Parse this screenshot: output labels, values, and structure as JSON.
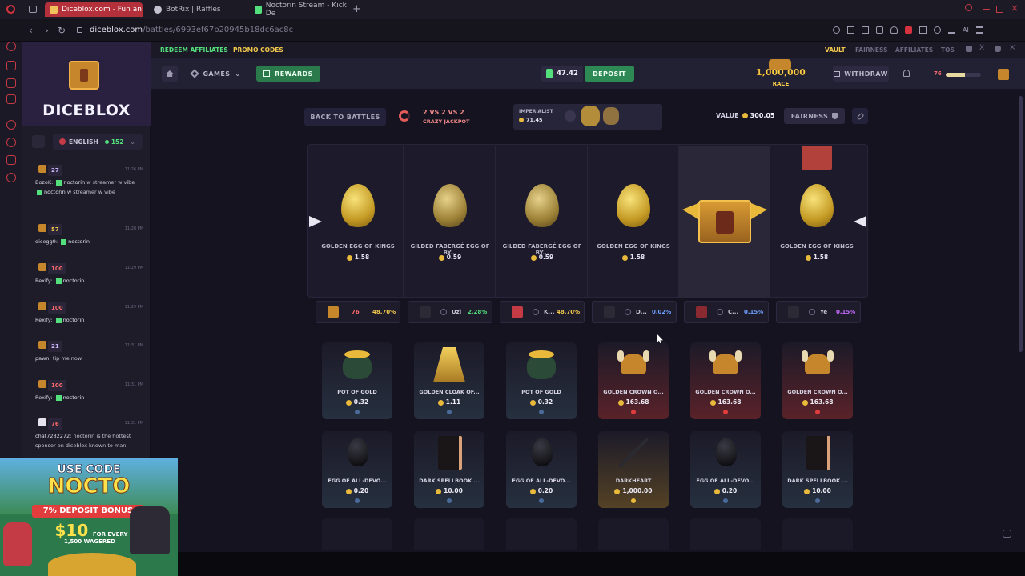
{
  "browser": {
    "tabs": [
      {
        "label": "Diceblox.com - Fun an"
      },
      {
        "label": "BotRix | Raffles"
      },
      {
        "label": "Noctorin Stream - Kick De"
      }
    ],
    "url_host": "diceblox.com",
    "url_path": "/battles/6993ef67b20945b18dc6ac8c"
  },
  "sidebar": {
    "logo_text": "DICEBLOX",
    "language": "ENGLISH",
    "online_count": "152",
    "chat": [
      {
        "level": "27",
        "time": "11:26 PM",
        "user": "BozoK:",
        "tag": "noctorin",
        "text": "w streamer w vibe",
        "tag2": "noctorin",
        "text2": "w streamer w vibe"
      },
      {
        "level": "57",
        "time": "11:28 PM",
        "user": "dicegg9:",
        "tag": "noctorin",
        "text": ""
      },
      {
        "level": "100",
        "time": "11:29 PM",
        "user": "Rexify:",
        "tag": "noctorin",
        "text": ""
      },
      {
        "level": "100",
        "time": "11:29 PM",
        "user": "Rexify:",
        "tag": "noctorin",
        "text": ""
      },
      {
        "level": "21",
        "time": "11:31 PM",
        "user": "pawn:",
        "tag": "",
        "text": "tip me now"
      },
      {
        "level": "100",
        "time": "11:31 PM",
        "user": "Rexify:",
        "tag": "noctorin",
        "text": ""
      },
      {
        "level": "76",
        "time": "11:31 PM",
        "user": "chat7282272:",
        "tag": "",
        "text": "noctorin is the hottest sponsor on diceblox known to man"
      }
    ]
  },
  "promo": {
    "line1": "USE CODE",
    "line2": "NOCTO",
    "line3": "7% DEPOSIT BONUS",
    "line4": "$10",
    "line5": "FOR EVERY",
    "line6": "1,500 WAGERED"
  },
  "topnav": {
    "left": [
      "REDEEM AFFILIATES",
      "PROMO CODES"
    ],
    "right": [
      "VAULT",
      "FAIRNESS",
      "AFFILIATES",
      "TOS"
    ]
  },
  "mainbar": {
    "games_label": "GAMES",
    "rewards_label": "REWARDS",
    "balance": "47.42",
    "deposit_label": "DEPOSIT",
    "race_amount": "1,000,000",
    "race_label": "RACE",
    "withdraw_label": "WITHDRAW",
    "user_level": "76"
  },
  "battle": {
    "back_label": "BACK TO BATTLES",
    "mode": "2 VS 2 VS 2",
    "mode_sub": "CRAZY JACKPOT",
    "creator_name": "IMPERIALIST",
    "creator_value": "71.45",
    "value_label": "VALUE",
    "value_amount": "300.05",
    "fairness_label": "FAIRNESS"
  },
  "spin_items": [
    {
      "name": "GOLDEN EGG OF KINGS",
      "price": "1.58"
    },
    {
      "name": "GILDED FABERGÉ EGG OF BY...",
      "price": "0.59"
    },
    {
      "name": "GILDED FABERGÉ EGG OF BY...",
      "price": "0.59"
    },
    {
      "name": "GOLDEN EGG OF KINGS",
      "price": "1.58"
    },
    {
      "name": "",
      "price": ""
    },
    {
      "name": "GOLDEN EGG OF KINGS",
      "price": "1.58"
    }
  ],
  "players": [
    {
      "name": "76",
      "pct": "48.70%",
      "pct_color": "#f2c94c"
    },
    {
      "name": "Uzi",
      "pct": "2.28%",
      "pct_color": "#53e07c"
    },
    {
      "name": "K...",
      "pct": "48.70%",
      "pct_color": "#f2c94c"
    },
    {
      "name": "D...",
      "pct": "0.02%",
      "pct_color": "#6ea0ff"
    },
    {
      "name": "C...",
      "pct": "0.15%",
      "pct_color": "#6ea0ff"
    },
    {
      "name": "Ye",
      "pct": "0.15%",
      "pct_color": "#c46bff"
    }
  ],
  "drops_row1": [
    {
      "name": "POT OF GOLD",
      "price": "0.32",
      "rarity": "blue"
    },
    {
      "name": "GOLDEN CLOAK OF...",
      "price": "1.11",
      "rarity": "blue"
    },
    {
      "name": "POT OF GOLD",
      "price": "0.32",
      "rarity": "blue"
    },
    {
      "name": "GOLDEN CROWN O...",
      "price": "163.68",
      "rarity": "red"
    },
    {
      "name": "GOLDEN CROWN O...",
      "price": "163.68",
      "rarity": "red"
    },
    {
      "name": "GOLDEN CROWN O...",
      "price": "163.68",
      "rarity": "red"
    }
  ],
  "drops_row2": [
    {
      "name": "EGG OF ALL-DEVO...",
      "price": "0.20",
      "rarity": "blue"
    },
    {
      "name": "DARK SPELLBOOK ...",
      "price": "10.00",
      "rarity": "blue"
    },
    {
      "name": "EGG OF ALL-DEVO...",
      "price": "0.20",
      "rarity": "blue"
    },
    {
      "name": "DARKHEART",
      "price": "1,000.00",
      "rarity": "gold"
    },
    {
      "name": "EGG OF ALL-DEVO...",
      "price": "0.20",
      "rarity": "blue"
    },
    {
      "name": "DARK SPELLBOOK ...",
      "price": "10.00",
      "rarity": "blue"
    }
  ]
}
